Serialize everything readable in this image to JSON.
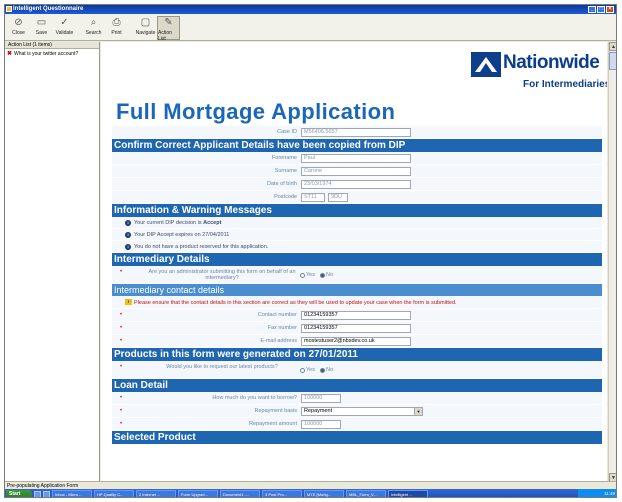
{
  "window": {
    "title": "Intelligent Questionnaire"
  },
  "toolbar": {
    "buttons": [
      {
        "label": "Close",
        "icon": "close-icon"
      },
      {
        "label": "Save",
        "icon": "save-icon"
      },
      {
        "label": "Validate",
        "icon": "validate-icon"
      },
      {
        "label": "Search",
        "icon": "search-icon"
      },
      {
        "label": "Print",
        "icon": "print-icon"
      },
      {
        "label": "Navigate",
        "icon": "navigate-icon"
      },
      {
        "label": "Action List",
        "icon": "action-list-icon"
      }
    ]
  },
  "action_list": {
    "header": "Action List (1 items)",
    "items": [
      "What is your twitter account?"
    ]
  },
  "brand": {
    "name": "Nationwide",
    "sub": "For Intermediaries"
  },
  "page_title": "Full Mortgage Application",
  "case": {
    "label": "Case ID",
    "value": "M56406.5657"
  },
  "sections": {
    "confirm": "Confirm Correct Applicant Details have been copied from DIP",
    "info_warn": "Information & Warning Messages",
    "intermediary": "Intermediary Details",
    "contact": "Intermediary contact details",
    "products": "Products in this form were generated on 27/01/2011",
    "loan": "Loan Detail",
    "selected": "Selected Product"
  },
  "applicant": {
    "forename_label": "Forename",
    "forename": "Paul",
    "surname_label": "Surname",
    "surname": "Carone",
    "dob_label": "Date of birth",
    "dob": "23/03/1974",
    "postcode_label": "Postcode",
    "postcode1": "ST11",
    "postcode2": "9DU"
  },
  "messages": [
    {
      "text": "Your current DIP decision is ",
      "bold": "Accept"
    },
    {
      "text": "Your DIP Accept expires on 27/04/2011",
      "bold": ""
    },
    {
      "text": "You do not have a product reserved for this application.",
      "bold": ""
    }
  ],
  "intermediary_q": {
    "label": "Are you an administrator submitting this form on behalf of an intermediary?",
    "yes": "Yes",
    "no": "No",
    "selected": "No"
  },
  "contact_warning": "Please ensure that the contact details in this section are correct as they will be used to update your case when the form is submitted.",
  "contact": {
    "phone_label": "Contact number",
    "phone": "01234159357",
    "fax_label": "Fax number",
    "fax": "01234159357",
    "email_label": "E-mail address",
    "email": "mostestuser2@nbsdev.co.uk"
  },
  "products_q": {
    "label": "Would you like to request our latest products?",
    "yes": "Yes",
    "no": "No",
    "selected": "No"
  },
  "loan": {
    "borrow_label": "How much do you want to borrow?",
    "borrow": "100000",
    "basis_label": "Repayment basis",
    "basis": "Repayment",
    "amount_label": "Repayment amount",
    "amount": "100000"
  },
  "status": "Pre-populating Application Form",
  "taskbar": {
    "start": "Start",
    "tasks": [
      "Inbox - Micro...",
      "HP Quality C...",
      "2 Internet ...",
      "Form Upgrad...",
      "Document1 -...",
      "3 Post Pro...",
      "MTE [Mortg...",
      "MBL_Form_V...",
      "Intelligent ..."
    ],
    "clock": "11:49"
  },
  "colors": {
    "header": "#1e66b2",
    "subheader": "#4a8ed0",
    "title": "#1a67b8",
    "brand": "#0c3e8c",
    "required": "#d01818"
  }
}
